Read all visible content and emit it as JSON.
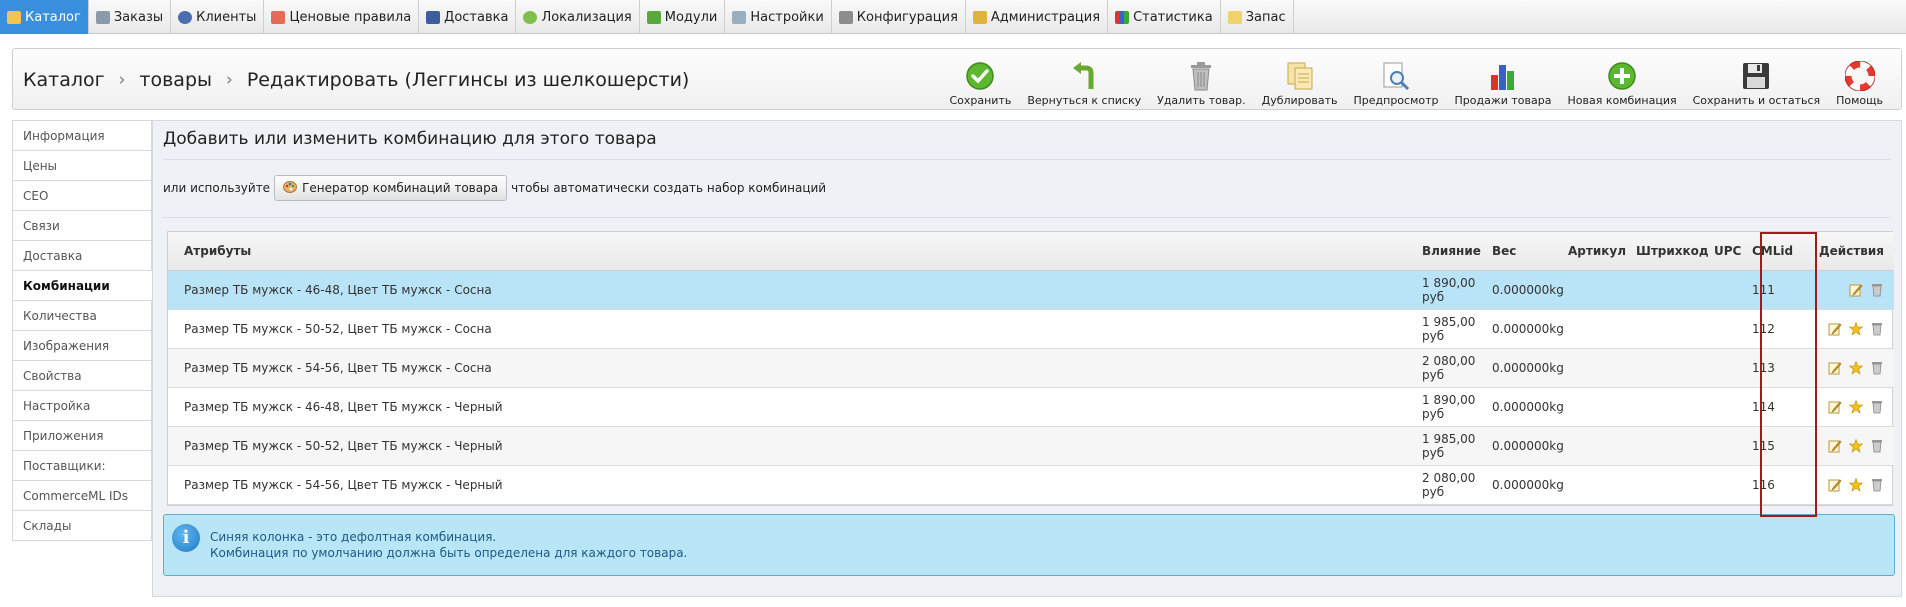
{
  "menu": [
    {
      "label": "Каталог",
      "icon": "folder-icon",
      "active": true
    },
    {
      "label": "Заказы",
      "icon": "cart-icon"
    },
    {
      "label": "Клиенты",
      "icon": "user-icon"
    },
    {
      "label": "Ценовые правила",
      "icon": "price-rule-icon"
    },
    {
      "label": "Доставка",
      "icon": "truck-icon"
    },
    {
      "label": "Локализация",
      "icon": "globe-icon"
    },
    {
      "label": "Модули",
      "icon": "puzzle-icon"
    },
    {
      "label": "Настройки",
      "icon": "settings-window-icon"
    },
    {
      "label": "Конфигурация",
      "icon": "wrench-icon"
    },
    {
      "label": "Администрация",
      "icon": "key-icon"
    },
    {
      "label": "Статистика",
      "icon": "bar-chart-icon"
    },
    {
      "label": "Запас",
      "icon": "stock-box-icon"
    }
  ],
  "breadcrumb": {
    "part1": "Каталог",
    "part2": "товары",
    "part3": "Редактировать (Леггинсы из шелкошерсти)"
  },
  "toolbar": [
    {
      "label": "Сохранить",
      "icon": "save-check-icon"
    },
    {
      "label": "Вернуться к списку",
      "icon": "back-arrow-icon"
    },
    {
      "label": "Удалить товар.",
      "icon": "trash-icon"
    },
    {
      "label": "Дублировать",
      "icon": "duplicate-icon"
    },
    {
      "label": "Предпросмотр",
      "icon": "preview-icon"
    },
    {
      "label": "Продажи товара",
      "icon": "sales-chart-icon"
    },
    {
      "label": "Новая комбинация",
      "icon": "plus-circle-icon"
    },
    {
      "label": "Сохранить и остаться",
      "icon": "floppy-icon"
    },
    {
      "label": "Помощь",
      "icon": "lifebuoy-icon"
    }
  ],
  "sidebar": [
    {
      "label": "Информация"
    },
    {
      "label": "Цены"
    },
    {
      "label": "СЕО"
    },
    {
      "label": "Связи"
    },
    {
      "label": "Доставка"
    },
    {
      "label": "Комбинации",
      "active": true
    },
    {
      "label": "Количества"
    },
    {
      "label": "Изображения"
    },
    {
      "label": "Свойства"
    },
    {
      "label": "Настройка"
    },
    {
      "label": "Приложения"
    },
    {
      "label": "Поставщики:"
    },
    {
      "label": "CommerceML IDs"
    },
    {
      "label": "Склады"
    }
  ],
  "main": {
    "title": "Добавить или изменить комбинацию для этого товара",
    "gen_prefix": "или используйте",
    "gen_button": "Генератор комбинаций товара",
    "gen_suffix": "чтобы автоматически создать набор комбинаций"
  },
  "table": {
    "headers": {
      "attributes": "Атрибуты",
      "impact": "Влияние",
      "weight": "Вес",
      "reference": "Артикул",
      "barcode": "Штрихкод",
      "upc": "UPC",
      "cmlid": "CMLid",
      "actions": "Действия"
    },
    "rows": [
      {
        "attributes": "Размер ТБ мужск - 46-48, Цвет ТБ мужск - Сосна",
        "impact1": "1 890,00",
        "impact2": "руб",
        "weight": "0.000000kg",
        "reference": "",
        "barcode": "",
        "upc": "",
        "cmlid": "111",
        "default": true
      },
      {
        "attributes": "Размер ТБ мужск - 50-52, Цвет ТБ мужск - Сосна",
        "impact1": "1 985,00",
        "impact2": "руб",
        "weight": "0.000000kg",
        "reference": "",
        "barcode": "",
        "upc": "",
        "cmlid": "112"
      },
      {
        "attributes": "Размер ТБ мужск - 54-56, Цвет ТБ мужск - Сосна",
        "impact1": "2 080,00",
        "impact2": "руб",
        "weight": "0.000000kg",
        "reference": "",
        "barcode": "",
        "upc": "",
        "cmlid": "113"
      },
      {
        "attributes": "Размер ТБ мужск - 46-48, Цвет ТБ мужск - Черный",
        "impact1": "1 890,00",
        "impact2": "руб",
        "weight": "0.000000kg",
        "reference": "",
        "barcode": "",
        "upc": "",
        "cmlid": "114"
      },
      {
        "attributes": "Размер ТБ мужск - 50-52, Цвет ТБ мужск - Черный",
        "impact1": "1 985,00",
        "impact2": "руб",
        "weight": "0.000000kg",
        "reference": "",
        "barcode": "",
        "upc": "",
        "cmlid": "115"
      },
      {
        "attributes": "Размер ТБ мужск - 54-56, Цвет ТБ мужск - Черный",
        "impact1": "2 080,00",
        "impact2": "руб",
        "weight": "0.000000kg",
        "reference": "",
        "barcode": "",
        "upc": "",
        "cmlid": "116"
      }
    ]
  },
  "info": {
    "line1": "Синяя колонка - это дефолтная комбинация.",
    "line2": "Комбинация по умолчанию должна быть определена для каждого товара."
  },
  "colors": {
    "active_tab": "#3a8fdd",
    "default_row": "#b9e3f7",
    "highlight_border": "#a11b1b",
    "info_bg": "#b9e6f7"
  }
}
